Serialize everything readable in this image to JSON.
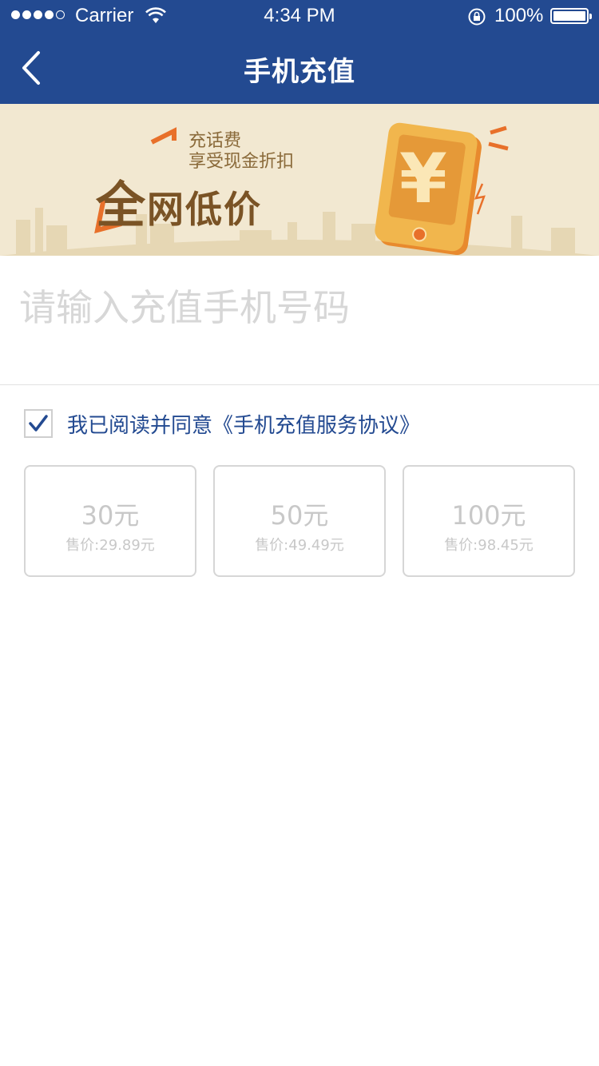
{
  "status_bar": {
    "carrier": "Carrier",
    "time": "4:34 PM",
    "battery": "100%"
  },
  "nav": {
    "title": "手机充值"
  },
  "banner": {
    "line1": "充话费",
    "line2": "享受现金折扣",
    "headline_big": "全",
    "headline_rest": "网低价",
    "yen_symbol": "¥",
    "colors": {
      "bg": "#f2e8d1",
      "text": "#7a5325",
      "phone": "#e8a33a",
      "accent": "#e8702a"
    }
  },
  "phone_input": {
    "placeholder": "请输入充值手机号码",
    "value": ""
  },
  "agreement": {
    "checked": true,
    "text": "我已阅读并同意",
    "link": "《手机充值服务协议》"
  },
  "options": [
    {
      "amount": "30元",
      "price": "售价:29.89元"
    },
    {
      "amount": "50元",
      "price": "售价:49.49元"
    },
    {
      "amount": "100元",
      "price": "售价:98.45元"
    }
  ],
  "theme": {
    "primary": "#234a91",
    "border": "#d6d6d6",
    "muted": "#c8c8c8"
  }
}
